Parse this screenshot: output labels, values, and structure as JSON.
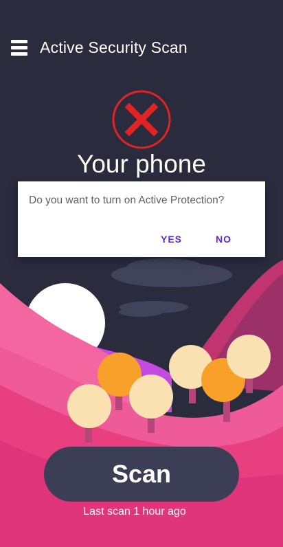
{
  "header": {
    "menu_icon": "hamburger-menu-icon",
    "title": "Active Security Scan"
  },
  "status": {
    "icon": "error-x-icon",
    "text": "Your phone",
    "icon_color": "#e02424"
  },
  "dialog": {
    "message": "Do you want to turn on Active Protection?",
    "yes_label": "YES",
    "no_label": "NO",
    "accent_color": "#5b2bd6"
  },
  "scan": {
    "button_label": "Scan",
    "last_scan_text": "Last scan 1 hour ago"
  },
  "colors": {
    "background": "#2a2b3d",
    "hill_pink": "#e8407f",
    "tree_orange": "#f7a02a",
    "tree_cream": "#f9e1b2"
  }
}
